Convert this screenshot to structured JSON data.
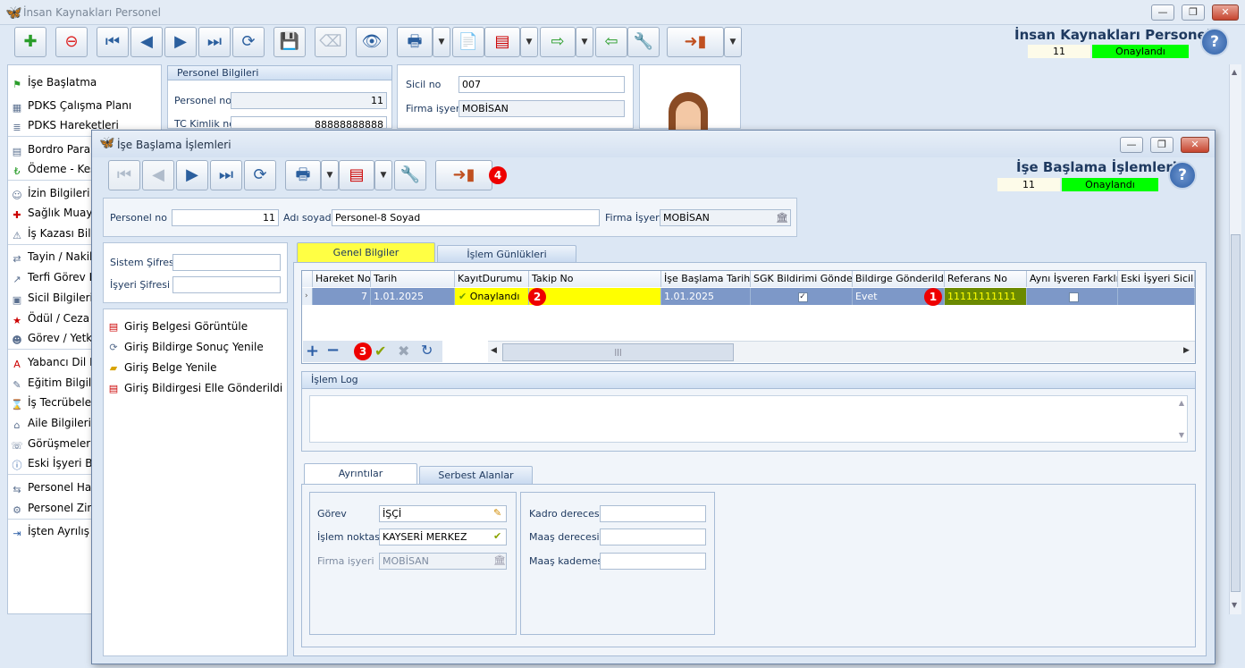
{
  "main": {
    "title": "İnsan Kaynakları Personel",
    "header_title": "İnsan Kaynakları Personel",
    "record_no": "11",
    "status": "Onaylandı",
    "sidebar": [
      {
        "label": "İşe Başlatma",
        "icon": "flag-icon"
      },
      {
        "label": "PDKS Çalışma Planı",
        "icon": "calendar-icon"
      },
      {
        "label": "PDKS Hareketleri",
        "icon": "list-icon"
      },
      {
        "label": "Bordro Paramet",
        "icon": "document-icon"
      },
      {
        "label": "Ödeme - Kesi",
        "icon": "money-icon"
      },
      {
        "label": "İzin Bilgileri",
        "icon": "person-icon"
      },
      {
        "label": "Sağlık Muaye",
        "icon": "health-icon"
      },
      {
        "label": "İş Kazası Bilgi",
        "icon": "accident-icon"
      },
      {
        "label": "Tayin / Nakil",
        "icon": "transfer-icon"
      },
      {
        "label": "Terfi Görev De",
        "icon": "promotion-icon"
      },
      {
        "label": "Sicil Bilgileri",
        "icon": "record-icon"
      },
      {
        "label": "Ödül / Ceza b",
        "icon": "award-icon"
      },
      {
        "label": "Görev / Yetkir",
        "icon": "role-icon"
      },
      {
        "label": "Yabancı Dil Bi",
        "icon": "language-icon"
      },
      {
        "label": "Eğitim Bilgile",
        "icon": "education-icon"
      },
      {
        "label": "İş Tecrübeleri",
        "icon": "experience-icon"
      },
      {
        "label": "Aile Bilgileri",
        "icon": "family-icon"
      },
      {
        "label": "Görüşmeler",
        "icon": "meeting-icon"
      },
      {
        "label": "Eski İşyeri Bilg",
        "icon": "info-icon"
      },
      {
        "label": "Personel Hare",
        "icon": "person-move-icon"
      },
      {
        "label": "Personel Zim",
        "icon": "person-item-icon"
      },
      {
        "label": "İşten Ayrılış",
        "icon": "exit-icon"
      }
    ],
    "personel_group": {
      "header": "Personel Bilgileri",
      "personel_no_label": "Personel no",
      "personel_no": "11",
      "tc_label": "TC Kimlik no",
      "tc": "88888888888"
    },
    "sicil": {
      "sicil_label": "Sicil no",
      "sicil": "007",
      "firma_label": "Firma işyeri",
      "firma": "MOBİSAN"
    }
  },
  "dialog": {
    "title": "İşe Başlama İşlemleri",
    "header_title": "İşe Başlama İşlemleri",
    "record_no": "11",
    "status": "Onaylandı",
    "personel_no_label": "Personel no",
    "personel_no": "11",
    "adsoyad_label": "Adı soyadı",
    "adsoyad": "Personel-8 Soyad",
    "firma_label": "Firma İşyeri",
    "firma": "MOBİSAN",
    "sistem_sifresi_label": "Sistem Şifresi",
    "isyeri_sifresi_label": "İşyeri Şifresi",
    "links": [
      {
        "label": "Giriş Belgesi Görüntüle",
        "icon": "pdf-icon"
      },
      {
        "label": "Giriş Bildirge Sonuç Yenile",
        "icon": "refresh-icon"
      },
      {
        "label": "Giriş Belge Yenile",
        "icon": "folder-icon"
      },
      {
        "label": "Giriş Bildirgesi Elle Gönderildi",
        "icon": "pdf-icon"
      }
    ],
    "tabs": [
      "Genel Bilgiler",
      "İşlem Günlükleri"
    ],
    "grid": {
      "columns": [
        "Hareket No",
        "Tarih",
        "KayıtDurumu",
        "Takip No",
        "İşe Başlama Tarihi",
        "SGK Bildirimi Gönderildi",
        "Bildirge Gönderildi",
        "Referans No",
        "Aynı İşveren Farklı İş",
        "Eski İşyeri Sicil No"
      ],
      "row": {
        "hareket_no": "7",
        "tarih": "1.01.2025",
        "kayit_durumu": "Onaylandı",
        "takip_no": "",
        "ise_baslama": "1.01.2025",
        "sgk": "checked",
        "bildirge": "Evet",
        "referans": "11111111111",
        "ayni_isveren": "unchecked",
        "eski_sicil": ""
      }
    },
    "islem_log_label": "İşlem Log",
    "sub_tabs": [
      "Ayrıntılar",
      "Serbest Alanlar"
    ],
    "gorev_label": "Görev",
    "gorev": "İŞÇİ",
    "islem_noktasi_label": "İşlem noktası",
    "islem_noktasi": "KAYSERİ MERKEZ",
    "firma_isyeri_label": "Firma işyeri",
    "firma_isyeri": "MOBİSAN",
    "kadro_label": "Kadro derecesi",
    "maas_derece_label": "Maaş derecesi",
    "maas_kademe_label": "Maaş kademesi",
    "badges": [
      "1",
      "2",
      "3",
      "4"
    ]
  },
  "colors": {
    "accent": "#1f3a60",
    "status_green": "#00ff00",
    "highlight_yellow": "#ffff00",
    "selected_row": "#7d98c8"
  }
}
